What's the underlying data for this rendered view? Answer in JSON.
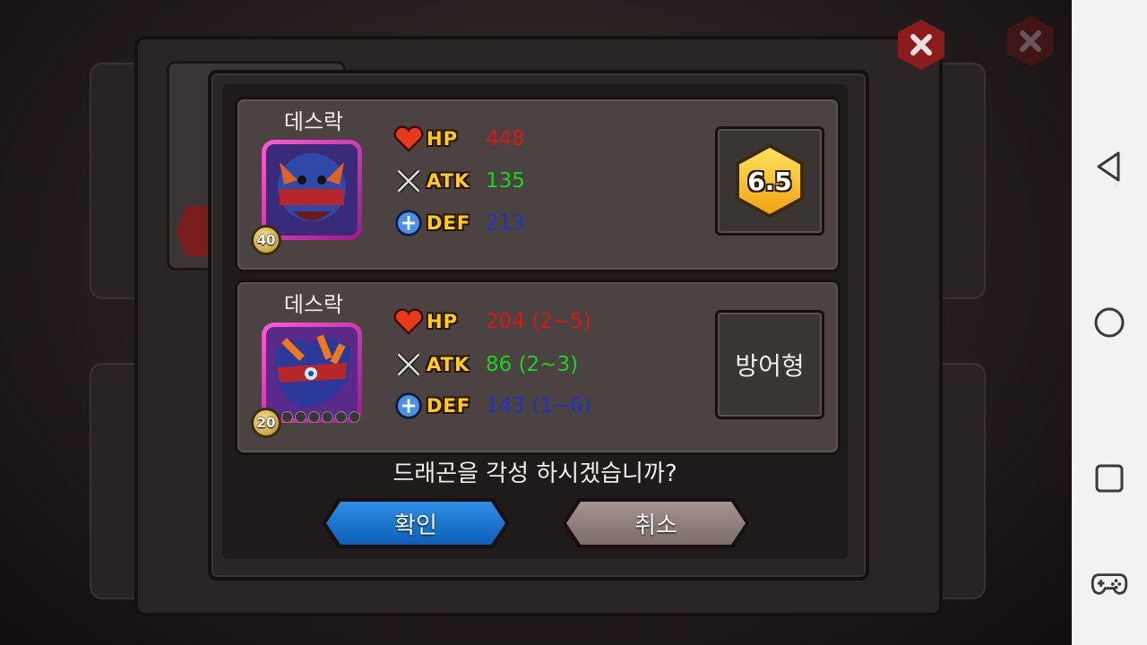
{
  "dialog": {
    "current": {
      "name": "데스락",
      "level": "40",
      "stats": {
        "hp_label": "HP",
        "hp_value": "448",
        "atk_label": "ATK",
        "atk_value": "135",
        "def_label": "DEF",
        "def_value": "213"
      },
      "grade": "6.5"
    },
    "awakened": {
      "name": "데스락",
      "level": "20",
      "stats": {
        "hp_label": "HP",
        "hp_value": "204 (2~5)",
        "atk_label": "ATK",
        "atk_value": "86 (2~3)",
        "def_label": "DEF",
        "def_value": "143 (1~6)"
      },
      "type": "방어형"
    },
    "question": "드래곤을 각성 하시겠습니까?",
    "confirm_label": "확인",
    "cancel_label": "취소"
  },
  "colors": {
    "hp": "#d81818",
    "atk": "#1fd21f",
    "def": "#2330c8",
    "confirm": "#1a6fd0",
    "cancel": "#8e7f7a"
  },
  "icons": [
    "close-icon",
    "heart-icon",
    "crossed-swords-icon",
    "shield-icon",
    "back-icon",
    "home-icon",
    "recents-icon",
    "gamepad-icon"
  ]
}
